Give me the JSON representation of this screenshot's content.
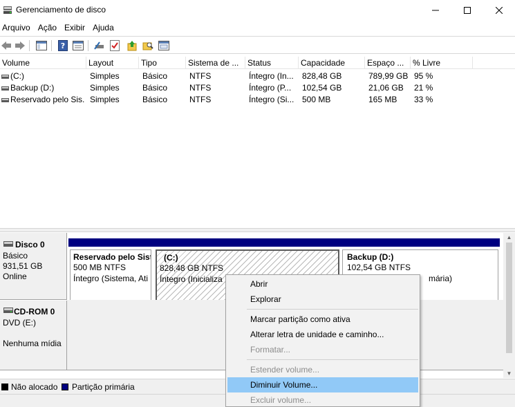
{
  "window": {
    "title": "Gerenciamento de disco",
    "icon": "disk-management-icon"
  },
  "menu": [
    "Arquivo",
    "Ação",
    "Exibir",
    "Ajuda"
  ],
  "toolbar": {
    "buttons": [
      "back-icon",
      "forward-icon",
      "console-tree-icon",
      "help-icon",
      "properties-icon",
      "connect-icon",
      "check-icon",
      "folder-up-icon",
      "search-folder-icon",
      "settings-panel-icon"
    ]
  },
  "volume_table": {
    "columns": [
      "Volume",
      "Layout",
      "Tipo",
      "Sistema de ...",
      "Status",
      "Capacidade",
      "Espaço ...",
      "% Livre"
    ],
    "rows": [
      [
        "(C:)",
        "Simples",
        "Básico",
        "NTFS",
        "Íntegro (In...",
        "828,48 GB",
        "789,99 GB",
        "95 %"
      ],
      [
        "Backup (D:)",
        "Simples",
        "Básico",
        "NTFS",
        "Íntegro (P...",
        "102,54 GB",
        "21,06 GB",
        "21 %"
      ],
      [
        "Reservado pelo Sis...",
        "Simples",
        "Básico",
        "NTFS",
        "Íntegro (Si...",
        "500 MB",
        "165 MB",
        "33 %"
      ]
    ]
  },
  "disk0": {
    "name": "Disco 0",
    "type": "Básico",
    "size": "931,51 GB",
    "state": "Online",
    "partitions": [
      {
        "name": "Reservado pelo Sist",
        "size": "500 MB NTFS",
        "status": "Íntegro (Sistema, Ati"
      },
      {
        "name": "(C:)",
        "size": "828,48 GB NTFS",
        "status": "Íntegro (Inicializa"
      },
      {
        "name": "Backup  (D:)",
        "size": "102,54 GB NTFS",
        "status": "mária)"
      }
    ]
  },
  "cdrom0": {
    "name": "CD-ROM 0",
    "drive": "DVD (E:)",
    "media": "Nenhuma mídia"
  },
  "legend": [
    {
      "label": "Não alocado",
      "color": "#000000"
    },
    {
      "label": "Partição primária",
      "color": "#000080"
    }
  ],
  "context_menu": {
    "items": [
      {
        "label": "Abrir",
        "state": "enabled"
      },
      {
        "label": "Explorar",
        "state": "enabled"
      },
      {
        "label": "Marcar partição como ativa",
        "state": "enabled"
      },
      {
        "label": "Alterar letra de unidade e caminho...",
        "state": "enabled"
      },
      {
        "label": "Formatar...",
        "state": "disabled"
      },
      {
        "label": "Estender volume...",
        "state": "disabled"
      },
      {
        "label": "Diminuir Volume...",
        "state": "highlighted"
      },
      {
        "label": "Excluir volume...",
        "state": "disabled"
      }
    ]
  },
  "colors": {
    "primary_partition": "#000080",
    "menu_highlight": "#91c9f7"
  }
}
